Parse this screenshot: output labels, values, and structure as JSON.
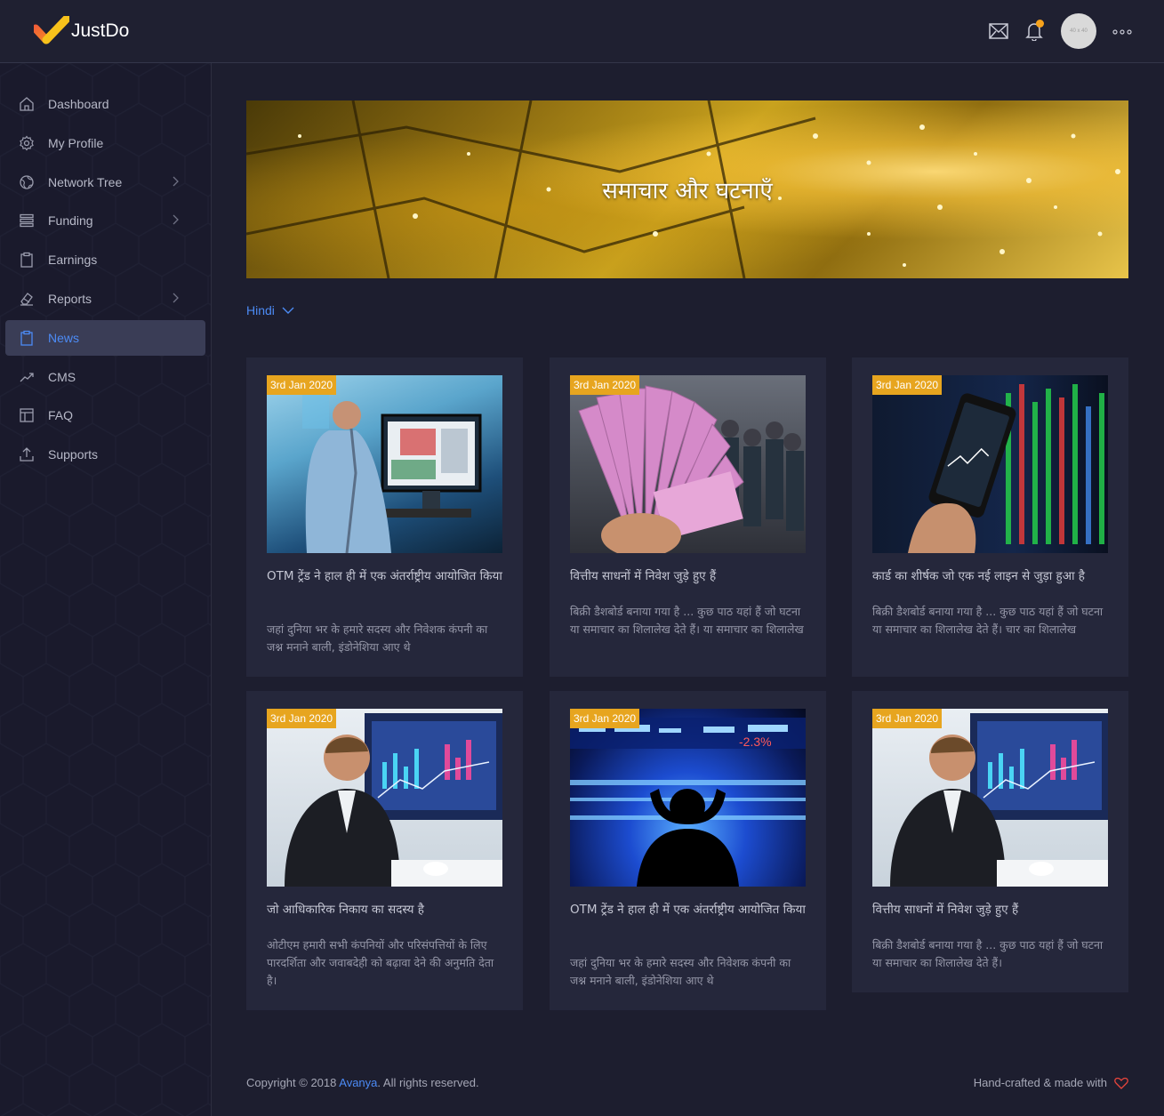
{
  "app": {
    "name": "JustDo"
  },
  "topbar": {
    "avatar_text": "40 x 40"
  },
  "sidebar": {
    "items": [
      {
        "label": "Dashboard",
        "icon": "home-icon",
        "chevron": false,
        "active": false
      },
      {
        "label": "My Profile",
        "icon": "gear-icon",
        "chevron": false,
        "active": false
      },
      {
        "label": "Network Tree",
        "icon": "globe-icon",
        "chevron": true,
        "active": false
      },
      {
        "label": "Funding",
        "icon": "layers-icon",
        "chevron": true,
        "active": false
      },
      {
        "label": "Earnings",
        "icon": "clipboard-icon",
        "chevron": false,
        "active": false
      },
      {
        "label": "Reports",
        "icon": "eraser-icon",
        "chevron": true,
        "active": false
      },
      {
        "label": "News",
        "icon": "clipboard-icon",
        "chevron": false,
        "active": true
      },
      {
        "label": "CMS",
        "icon": "trending-icon",
        "chevron": false,
        "active": false
      },
      {
        "label": "FAQ",
        "icon": "layout-icon",
        "chevron": false,
        "active": false
      },
      {
        "label": "Supports",
        "icon": "upload-icon",
        "chevron": false,
        "active": false
      }
    ]
  },
  "banner": {
    "title": "समाचार और घटनाएँ"
  },
  "language": {
    "selected": "Hindi"
  },
  "cards": [
    {
      "date": "3rd Jan 2020",
      "title": "OTM ट्रेंड ने हाल ही में एक अंतर्राष्ट्रीय आयोजित किया",
      "text": "जहां दुनिया भर के हमारे सदस्य और निवेशक कंपनी का जश्न मनाने बाली, इंडोनेशिया आए थे",
      "image": "analyst-monitor"
    },
    {
      "date": "3rd Jan 2020",
      "title": "वित्तीय साधनों में निवेश जुड़े हुए हैं",
      "text": "बिक्री डैशबोर्ड बनाया गया है ... कुछ पाठ यहां हैं जो घटना या समाचार का शिलालेख देते हैं। या समाचार का शिलालेख",
      "image": "currency-fan"
    },
    {
      "date": "3rd Jan 2020",
      "title": "कार्ड का शीर्षक जो एक नई लाइन से जुड़ा हुआ है",
      "text": "बिक्री डैशबोर्ड बनाया गया है ... कुछ पाठ यहां हैं जो घटना या समाचार का शिलालेख देते हैं। चार का शिलालेख",
      "image": "phone-ticker"
    },
    {
      "date": "3rd Jan 2020",
      "title": "जो आधिकारिक निकाय का सदस्य है",
      "text": "ओटीएम हमारी सभी कंपनियों और परिसंपत्तियों के लिए पारदर्शिता और जवाबदेही को बढ़ावा देने की अनुमति देता है।",
      "image": "trader-phone"
    },
    {
      "date": "3rd Jan 2020",
      "title": "OTM ट्रेंड ने हाल ही में एक अंतर्राष्ट्रीय आयोजित किया",
      "text": "जहां दुनिया भर के हमारे सदस्य और निवेशक कंपनी का जश्न मनाने बाली, इंडोनेशिया आए थे",
      "image": "silhouette-screens"
    },
    {
      "date": "3rd Jan 2020",
      "title": "वित्तीय साधनों में निवेश जुड़े हुए हैं",
      "text": "बिक्री डैशबोर्ड बनाया गया है ... कुछ पाठ यहां हैं जो घटना या समाचार का शिलालेख देते हैं।",
      "image": "trader-phone"
    }
  ],
  "footer": {
    "copyright_prefix": "Copyright © 2018 ",
    "company": "Avanya",
    "copyright_suffix": ". All rights reserved.",
    "handcrafted": "Hand-crafted & made with"
  },
  "colors": {
    "accent": "#4c8bf5",
    "badge": "#e7a51f",
    "logo_orange": "#f7a21b",
    "heart": "#e8453c"
  }
}
